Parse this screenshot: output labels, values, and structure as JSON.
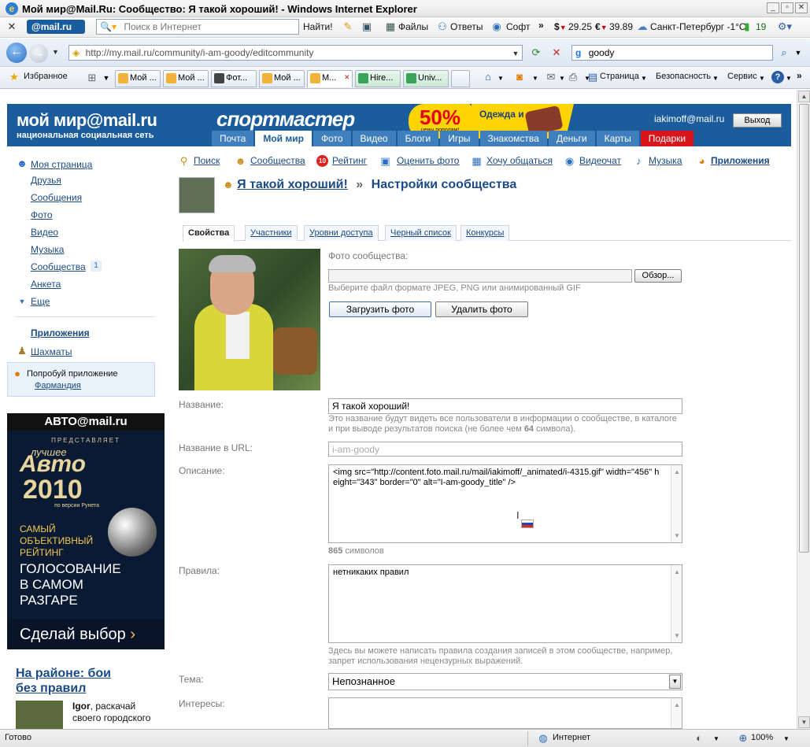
{
  "window": {
    "title": "Мой мир@Mail.Ru: Сообщество: Я такой хороший! - Windows Internet Explorer"
  },
  "toolbar_mail": {
    "logo": "@mail.ru",
    "search_placeholder": "Поиск в Интернет",
    "find_button": "Найти!",
    "files": "Файлы",
    "answers": "Ответы",
    "soft": "Софт",
    "usd": "29.25",
    "eur": "39.89",
    "weather": "Санкт-Петербург -1°С",
    "count": "19"
  },
  "address_bar": {
    "url": "http://my.mail.ru/community/i-am-goody/editcommunity",
    "search_value": "goody"
  },
  "favorites_bar": {
    "favorites": "Избранное",
    "tabs": [
      "Мой ...",
      "Мой ...",
      "Фот...",
      "Мой ...",
      "М...",
      "Hire...",
      "Univ..."
    ],
    "page_menu": "Страница",
    "security_menu": "Безопасность",
    "service_menu": "Сервис"
  },
  "header": {
    "logo": "мой мир@mail.ru",
    "logo_sub": "национальная социальная сеть",
    "ad_brand": "спортмастер",
    "ad_percent": "50%",
    "ad_percent_sub": "цены пополам!",
    "ad_clothes": "Одежда и обувь",
    "user_email": "iakimoff@mail.ru",
    "logout": "Выход",
    "nav": [
      "Почта",
      "Мой мир",
      "Фото",
      "Видео",
      "Блоги",
      "Игры",
      "Знакомства",
      "Деньги",
      "Карты",
      "Подарки"
    ]
  },
  "sidebar": {
    "items": [
      "Моя страница",
      "Друзья",
      "Сообщения",
      "Фото",
      "Видео",
      "Музыка",
      "Сообщества",
      "Анкета",
      "Еще"
    ],
    "communities_badge": "1",
    "apps": "Приложения",
    "chess": "Шахматы",
    "promo_text": "Попробуй приложение",
    "promo_link": "Фармандия",
    "ad": {
      "header": "АВТО@mail.ru",
      "presents": "ПРЕДСТАВЛЯЕТ",
      "best": "лучшее",
      "auto": "Авто",
      "year": "2010",
      "runet": "по версии Рунета",
      "rating": "САМЫЙ ОБЪЕКТИВНЫЙ РЕЙТИНГ",
      "voting": "ГОЛОСОВАНИЕ В САМОМ РАЗГАРЕ",
      "cta": "Сделай выбор"
    },
    "raion_title": "На районе: бои без правил",
    "raion_user": "Igor",
    "raion_text": ", раскачай своего городского"
  },
  "topnav": [
    "Поиск",
    "Сообщества",
    "Рейтинг",
    "Оценить фото",
    "Хочу общаться",
    "Видеочат",
    "Музыка",
    "Приложения"
  ],
  "community": {
    "name": "Я такой хороший!",
    "separator": "»",
    "page_title": "Настройки сообщества"
  },
  "subtabs": [
    "Свойства",
    "Участники",
    "Уровни доступа",
    "Черный список",
    "Конкурсы"
  ],
  "form": {
    "photo_label": "Фото сообщества:",
    "browse_button": "Обзор...",
    "photo_hint": "Выберите файл формате JPEG, PNG или анимированный GIF",
    "upload_button": "Загрузить фото",
    "delete_button": "Удалить фото",
    "name_label": "Название:",
    "name_value": "Я такой хороший!",
    "name_hint_1": "Это название будут видеть все пользователи в информации о сообществе, в каталоге",
    "name_hint_2": "и при выводе результатов поиска (не более чем ",
    "name_hint_num": "64",
    "name_hint_3": " символа).",
    "url_label": "Название в URL:",
    "url_value": "i-am-goody",
    "desc_label": "Описание:",
    "desc_value": "<img src=\"http://content.foto.mail.ru/mail/iakimoff/_animated/i-4315.gif\" width=\"456\" height=\"343\" border=\"0\" alt=\"I-am-goody_title\" />",
    "desc_count": "865",
    "desc_count_suffix": " символов",
    "rules_label": "Правила:",
    "rules_value": "нетникаких правил",
    "rules_hint_1": "Здесь вы можете написать правила создания записей в этом сообществе, например,",
    "rules_hint_2": "запрет использования нецензурных выражений.",
    "theme_label": "Тема:",
    "theme_value": "Непознанное",
    "interests_label": "Интересы:"
  },
  "statusbar": {
    "text": "Готово",
    "zone": "Интернет",
    "zoom": "100%"
  }
}
